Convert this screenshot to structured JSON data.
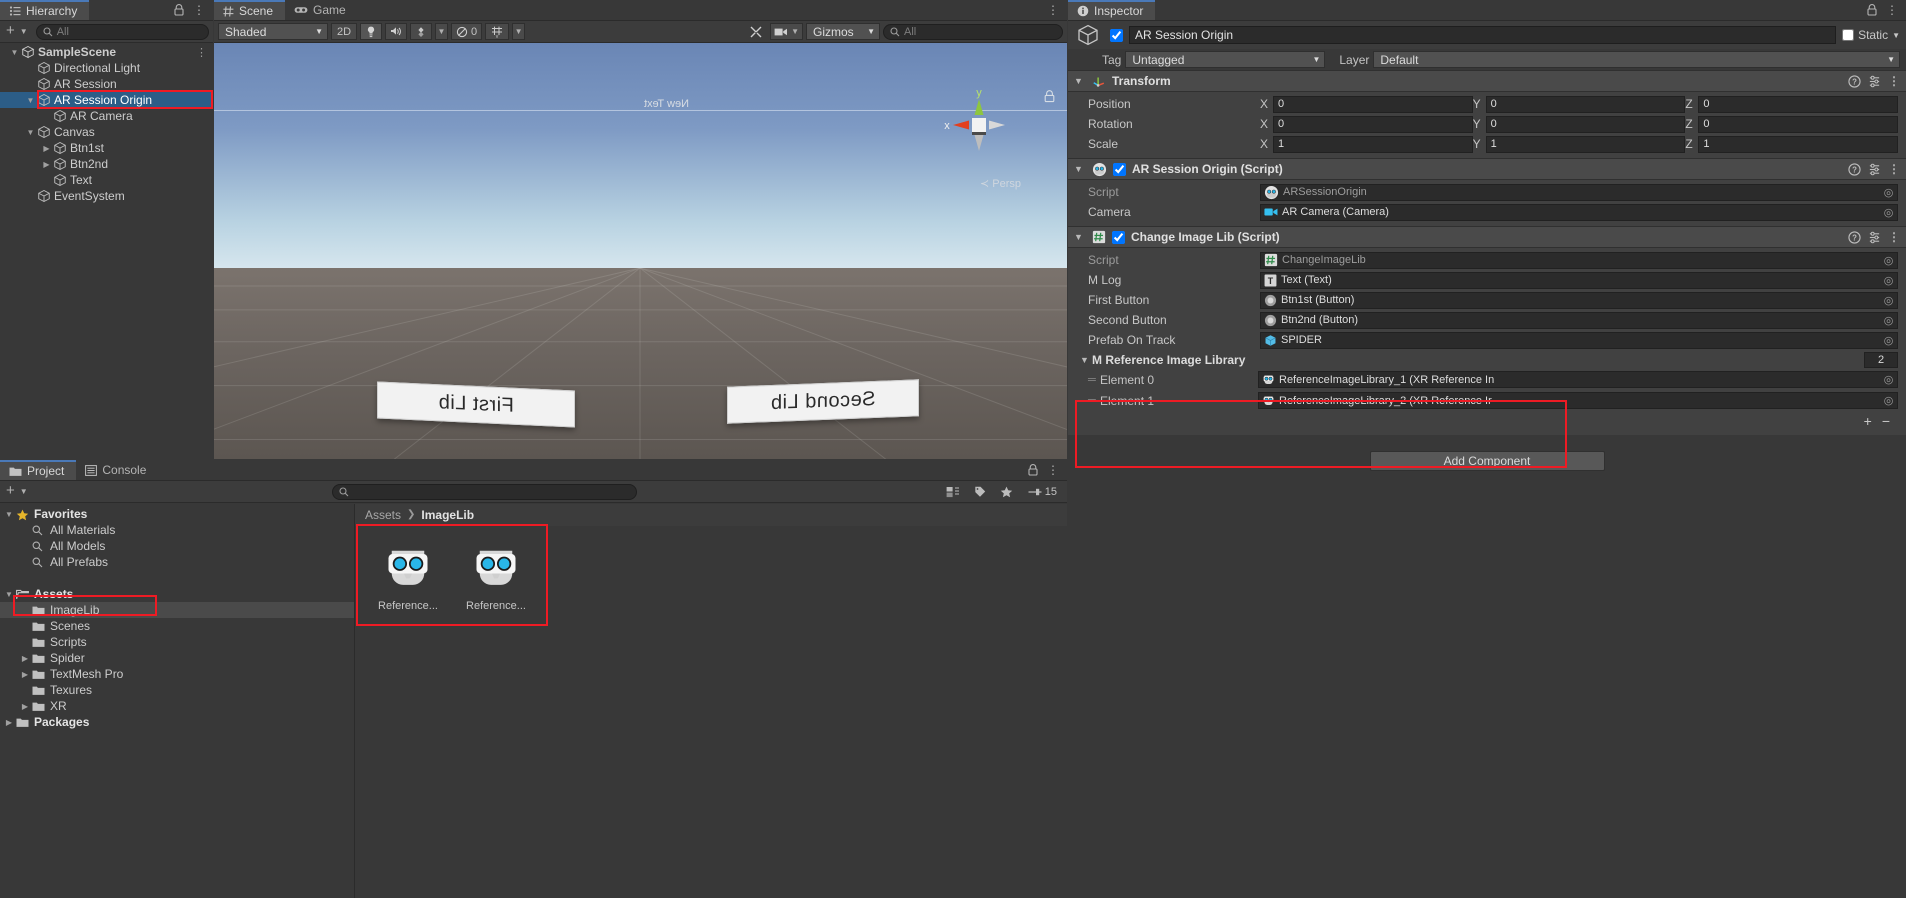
{
  "hierarchy": {
    "tab": "Hierarchy",
    "search_placeholder": "All",
    "create_label": "+",
    "items": [
      {
        "label": "SampleScene",
        "depth": 0,
        "type": "scene",
        "expanded": true,
        "selected": false,
        "arrow": "▼"
      },
      {
        "label": "Directional Light",
        "depth": 1,
        "type": "go",
        "expanded": null,
        "selected": false,
        "arrow": ""
      },
      {
        "label": "AR Session",
        "depth": 1,
        "type": "go",
        "expanded": null,
        "selected": false,
        "arrow": ""
      },
      {
        "label": "AR Session Origin",
        "depth": 1,
        "type": "go",
        "expanded": true,
        "selected": true,
        "arrow": "▼"
      },
      {
        "label": "AR Camera",
        "depth": 2,
        "type": "go",
        "expanded": null,
        "selected": false,
        "arrow": ""
      },
      {
        "label": "Canvas",
        "depth": 1,
        "type": "go",
        "expanded": true,
        "selected": false,
        "arrow": "▼"
      },
      {
        "label": "Btn1st",
        "depth": 2,
        "type": "go",
        "expanded": false,
        "selected": false,
        "arrow": "▶"
      },
      {
        "label": "Btn2nd",
        "depth": 2,
        "type": "go",
        "expanded": false,
        "selected": false,
        "arrow": "▶"
      },
      {
        "label": "Text",
        "depth": 2,
        "type": "go",
        "expanded": null,
        "selected": false,
        "arrow": ""
      },
      {
        "label": "EventSystem",
        "depth": 1,
        "type": "go",
        "expanded": null,
        "selected": false,
        "arrow": ""
      }
    ]
  },
  "scene": {
    "tabs": [
      {
        "label": "Scene",
        "active": true
      },
      {
        "label": "Game",
        "active": false
      }
    ],
    "toolbar": {
      "shading": "Shaded",
      "mode_2d": "2D",
      "audio_count": "0",
      "gizmos": "Gizmos",
      "search_placeholder": "All"
    },
    "gizmo": {
      "x_label": "x",
      "y_label": "y",
      "persp_label": "Persp"
    },
    "world_text": "New Text",
    "signs": [
      "First Lib",
      "Second Lib"
    ]
  },
  "inspector": {
    "tab": "Inspector",
    "object_name": "AR Session Origin",
    "enabled": true,
    "static_label": "Static",
    "tag_label": "Tag",
    "tag_value": "Untagged",
    "layer_label": "Layer",
    "layer_value": "Default",
    "components": [
      {
        "title": "Transform",
        "icon": "transform-icon",
        "has_toggle": false,
        "rows": [
          {
            "label": "Position",
            "type": "vector3",
            "x": "0",
            "y": "0",
            "z": "0"
          },
          {
            "label": "Rotation",
            "type": "vector3",
            "x": "0",
            "y": "0",
            "z": "0"
          },
          {
            "label": "Scale",
            "type": "vector3",
            "x": "1",
            "y": "1",
            "z": "1"
          }
        ]
      },
      {
        "title": "AR Session Origin (Script)",
        "icon": "ar-script-icon",
        "has_toggle": true,
        "enabled": true,
        "rows": [
          {
            "label": "Script",
            "type": "object",
            "value": "ARSessionOrigin",
            "dim": true,
            "icon": "ar-script-icon"
          },
          {
            "label": "Camera",
            "type": "object",
            "value": "AR Camera (Camera)",
            "dim": false,
            "icon": "camera-icon"
          }
        ]
      },
      {
        "title": "Change Image Lib (Script)",
        "icon": "csharp-icon",
        "has_toggle": true,
        "enabled": true,
        "rows": [
          {
            "label": "Script",
            "type": "object",
            "value": "ChangeImageLib",
            "dim": true,
            "icon": "csharp-icon"
          },
          {
            "label": "M Log",
            "type": "object",
            "value": "Text (Text)",
            "dim": false,
            "icon": "text-icon"
          },
          {
            "label": "First Button",
            "type": "object",
            "value": "Btn1st (Button)",
            "dim": false,
            "icon": "button-icon"
          },
          {
            "label": "Second Button",
            "type": "object",
            "value": "Btn2nd (Button)",
            "dim": false,
            "icon": "button-icon"
          },
          {
            "label": "Prefab On Track",
            "type": "object",
            "value": "SPIDER",
            "dim": false,
            "icon": "prefab-icon"
          }
        ],
        "array": {
          "label": "M Reference Image Library",
          "size": "2",
          "elements": [
            {
              "label": "Element 0",
              "value": "ReferenceImageLibrary_1 (XR Reference In"
            },
            {
              "label": "Element 1",
              "value": "ReferenceImageLibrary_2 (XR Reference Ir"
            }
          ],
          "add_label": "+",
          "remove_label": "−"
        }
      }
    ],
    "add_component_label": "Add Component"
  },
  "project": {
    "tabs": [
      {
        "label": "Project",
        "active": true
      },
      {
        "label": "Console",
        "active": false
      }
    ],
    "create_label": "+",
    "search_placeholder": "",
    "item_count": "15",
    "tree": [
      {
        "label": "Favorites",
        "depth": 0,
        "arrow": "▼",
        "icon": "star-icon",
        "bold": true,
        "selected": false
      },
      {
        "label": "All Materials",
        "depth": 1,
        "arrow": "",
        "icon": "search-icon",
        "bold": false,
        "selected": false
      },
      {
        "label": "All Models",
        "depth": 1,
        "arrow": "",
        "icon": "search-icon",
        "bold": false,
        "selected": false
      },
      {
        "label": "All Prefabs",
        "depth": 1,
        "arrow": "",
        "icon": "search-icon",
        "bold": false,
        "selected": false
      },
      {
        "label": "",
        "depth": 0,
        "arrow": "",
        "icon": "none",
        "bold": false,
        "selected": false
      },
      {
        "label": "Assets",
        "depth": 0,
        "arrow": "▼",
        "icon": "folder-open-icon",
        "bold": true,
        "selected": false
      },
      {
        "label": "ImageLib",
        "depth": 1,
        "arrow": "",
        "icon": "folder-icon",
        "bold": false,
        "selected": true
      },
      {
        "label": "Scenes",
        "depth": 1,
        "arrow": "",
        "icon": "folder-icon",
        "bold": false,
        "selected": false
      },
      {
        "label": "Scripts",
        "depth": 1,
        "arrow": "",
        "icon": "folder-icon",
        "bold": false,
        "selected": false
      },
      {
        "label": "Spider",
        "depth": 1,
        "arrow": "▶",
        "icon": "folder-icon",
        "bold": false,
        "selected": false
      },
      {
        "label": "TextMesh Pro",
        "depth": 1,
        "arrow": "▶",
        "icon": "folder-icon",
        "bold": false,
        "selected": false
      },
      {
        "label": "Texures",
        "depth": 1,
        "arrow": "",
        "icon": "folder-icon",
        "bold": false,
        "selected": false
      },
      {
        "label": "XR",
        "depth": 1,
        "arrow": "▶",
        "icon": "folder-icon",
        "bold": false,
        "selected": false
      },
      {
        "label": "Packages",
        "depth": 0,
        "arrow": "▶",
        "icon": "folder-icon",
        "bold": true,
        "selected": false
      }
    ],
    "breadcrumb": [
      "Assets",
      "ImageLib"
    ],
    "assets": [
      {
        "label": "Reference...",
        "icon": "xr-reference-image-library-icon"
      },
      {
        "label": "Reference...",
        "icon": "xr-reference-image-library-icon"
      }
    ]
  },
  "colors": {
    "annotation": "#ee1b24",
    "selection": "#2c5d87",
    "panel": "#383838",
    "panel_alt": "#414141",
    "header": "#4a4a4a"
  }
}
